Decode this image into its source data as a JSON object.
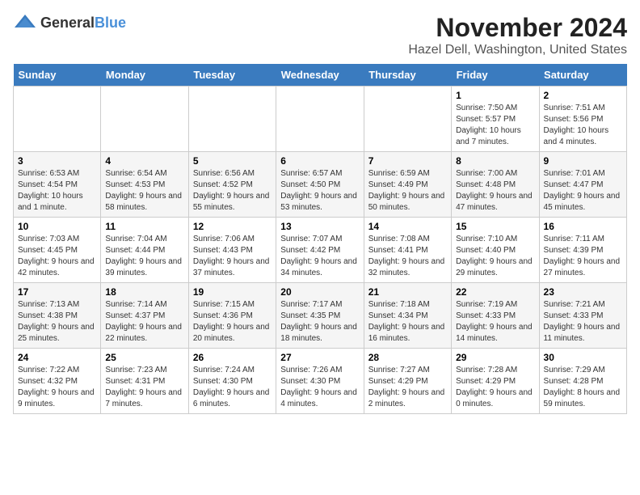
{
  "header": {
    "logo_general": "General",
    "logo_blue": "Blue",
    "title": "November 2024",
    "subtitle": "Hazel Dell, Washington, United States"
  },
  "calendar": {
    "weekdays": [
      "Sunday",
      "Monday",
      "Tuesday",
      "Wednesday",
      "Thursday",
      "Friday",
      "Saturday"
    ],
    "weeks": [
      [
        {
          "day": "",
          "info": ""
        },
        {
          "day": "",
          "info": ""
        },
        {
          "day": "",
          "info": ""
        },
        {
          "day": "",
          "info": ""
        },
        {
          "day": "",
          "info": ""
        },
        {
          "day": "1",
          "info": "Sunrise: 7:50 AM\nSunset: 5:57 PM\nDaylight: 10 hours and 7 minutes."
        },
        {
          "day": "2",
          "info": "Sunrise: 7:51 AM\nSunset: 5:56 PM\nDaylight: 10 hours and 4 minutes."
        }
      ],
      [
        {
          "day": "3",
          "info": "Sunrise: 6:53 AM\nSunset: 4:54 PM\nDaylight: 10 hours and 1 minute."
        },
        {
          "day": "4",
          "info": "Sunrise: 6:54 AM\nSunset: 4:53 PM\nDaylight: 9 hours and 58 minutes."
        },
        {
          "day": "5",
          "info": "Sunrise: 6:56 AM\nSunset: 4:52 PM\nDaylight: 9 hours and 55 minutes."
        },
        {
          "day": "6",
          "info": "Sunrise: 6:57 AM\nSunset: 4:50 PM\nDaylight: 9 hours and 53 minutes."
        },
        {
          "day": "7",
          "info": "Sunrise: 6:59 AM\nSunset: 4:49 PM\nDaylight: 9 hours and 50 minutes."
        },
        {
          "day": "8",
          "info": "Sunrise: 7:00 AM\nSunset: 4:48 PM\nDaylight: 9 hours and 47 minutes."
        },
        {
          "day": "9",
          "info": "Sunrise: 7:01 AM\nSunset: 4:47 PM\nDaylight: 9 hours and 45 minutes."
        }
      ],
      [
        {
          "day": "10",
          "info": "Sunrise: 7:03 AM\nSunset: 4:45 PM\nDaylight: 9 hours and 42 minutes."
        },
        {
          "day": "11",
          "info": "Sunrise: 7:04 AM\nSunset: 4:44 PM\nDaylight: 9 hours and 39 minutes."
        },
        {
          "day": "12",
          "info": "Sunrise: 7:06 AM\nSunset: 4:43 PM\nDaylight: 9 hours and 37 minutes."
        },
        {
          "day": "13",
          "info": "Sunrise: 7:07 AM\nSunset: 4:42 PM\nDaylight: 9 hours and 34 minutes."
        },
        {
          "day": "14",
          "info": "Sunrise: 7:08 AM\nSunset: 4:41 PM\nDaylight: 9 hours and 32 minutes."
        },
        {
          "day": "15",
          "info": "Sunrise: 7:10 AM\nSunset: 4:40 PM\nDaylight: 9 hours and 29 minutes."
        },
        {
          "day": "16",
          "info": "Sunrise: 7:11 AM\nSunset: 4:39 PM\nDaylight: 9 hours and 27 minutes."
        }
      ],
      [
        {
          "day": "17",
          "info": "Sunrise: 7:13 AM\nSunset: 4:38 PM\nDaylight: 9 hours and 25 minutes."
        },
        {
          "day": "18",
          "info": "Sunrise: 7:14 AM\nSunset: 4:37 PM\nDaylight: 9 hours and 22 minutes."
        },
        {
          "day": "19",
          "info": "Sunrise: 7:15 AM\nSunset: 4:36 PM\nDaylight: 9 hours and 20 minutes."
        },
        {
          "day": "20",
          "info": "Sunrise: 7:17 AM\nSunset: 4:35 PM\nDaylight: 9 hours and 18 minutes."
        },
        {
          "day": "21",
          "info": "Sunrise: 7:18 AM\nSunset: 4:34 PM\nDaylight: 9 hours and 16 minutes."
        },
        {
          "day": "22",
          "info": "Sunrise: 7:19 AM\nSunset: 4:33 PM\nDaylight: 9 hours and 14 minutes."
        },
        {
          "day": "23",
          "info": "Sunrise: 7:21 AM\nSunset: 4:33 PM\nDaylight: 9 hours and 11 minutes."
        }
      ],
      [
        {
          "day": "24",
          "info": "Sunrise: 7:22 AM\nSunset: 4:32 PM\nDaylight: 9 hours and 9 minutes."
        },
        {
          "day": "25",
          "info": "Sunrise: 7:23 AM\nSunset: 4:31 PM\nDaylight: 9 hours and 7 minutes."
        },
        {
          "day": "26",
          "info": "Sunrise: 7:24 AM\nSunset: 4:30 PM\nDaylight: 9 hours and 6 minutes."
        },
        {
          "day": "27",
          "info": "Sunrise: 7:26 AM\nSunset: 4:30 PM\nDaylight: 9 hours and 4 minutes."
        },
        {
          "day": "28",
          "info": "Sunrise: 7:27 AM\nSunset: 4:29 PM\nDaylight: 9 hours and 2 minutes."
        },
        {
          "day": "29",
          "info": "Sunrise: 7:28 AM\nSunset: 4:29 PM\nDaylight: 9 hours and 0 minutes."
        },
        {
          "day": "30",
          "info": "Sunrise: 7:29 AM\nSunset: 4:28 PM\nDaylight: 8 hours and 59 minutes."
        }
      ]
    ]
  }
}
